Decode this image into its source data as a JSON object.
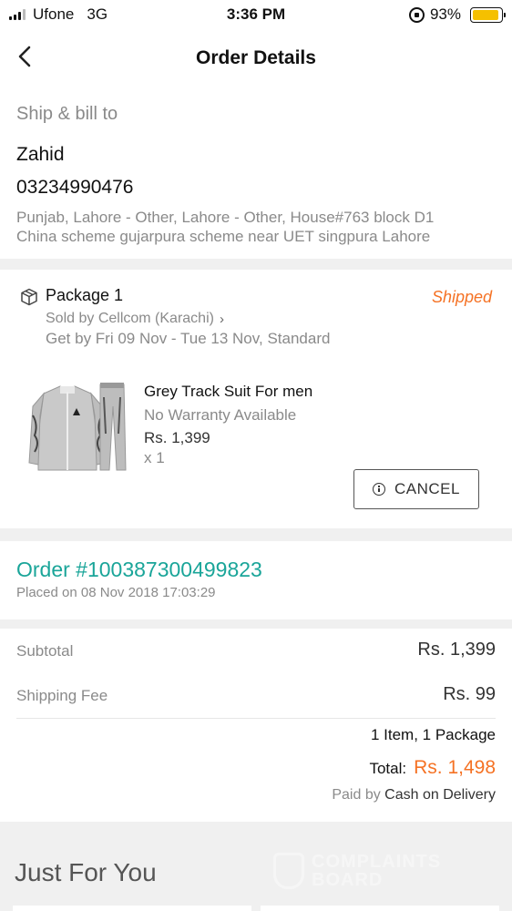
{
  "status_bar": {
    "carrier": "Ufone",
    "network": "3G",
    "time": "3:36 PM",
    "battery": "93%",
    "battery_level": 0.93
  },
  "nav": {
    "title": "Order Details"
  },
  "shipping": {
    "heading": "Ship & bill to",
    "name": "Zahid",
    "phone": "03234990476",
    "address_line1": "Punjab, Lahore - Other, Lahore - Other, House#763 block D1",
    "address_line2": "China scheme gujarpura scheme near UET singpura Lahore"
  },
  "package": {
    "title": "Package 1",
    "status": "Shipped",
    "status_color": "#f57224",
    "seller": "Sold by Cellcom (Karachi)",
    "delivery": "Get by Fri 09 Nov - Tue 13 Nov, Standard",
    "product": {
      "name": "Grey Track Suit For men",
      "warranty": "No Warranty Available",
      "price": "Rs. 1,399",
      "quantity": "x 1"
    },
    "cancel_label": "CANCEL"
  },
  "order": {
    "number": "Order #100387300499823",
    "placed": "Placed on 08 Nov 2018  17:03:29",
    "accent_color": "#1aa599"
  },
  "summary": {
    "subtotal_label": "Subtotal",
    "subtotal_value": "Rs. 1,399",
    "shipping_label": "Shipping Fee",
    "shipping_value": "Rs. 99",
    "items_count": "1 Item, 1 Package",
    "total_label": "Total:",
    "total_value": "Rs. 1,498",
    "paid_by_label": "Paid by",
    "payment_method": "Cash on Delivery"
  },
  "recommendations": {
    "heading": "Just For You"
  },
  "watermark": {
    "line1": "COMPLAINTS",
    "line2": "BOARD"
  }
}
